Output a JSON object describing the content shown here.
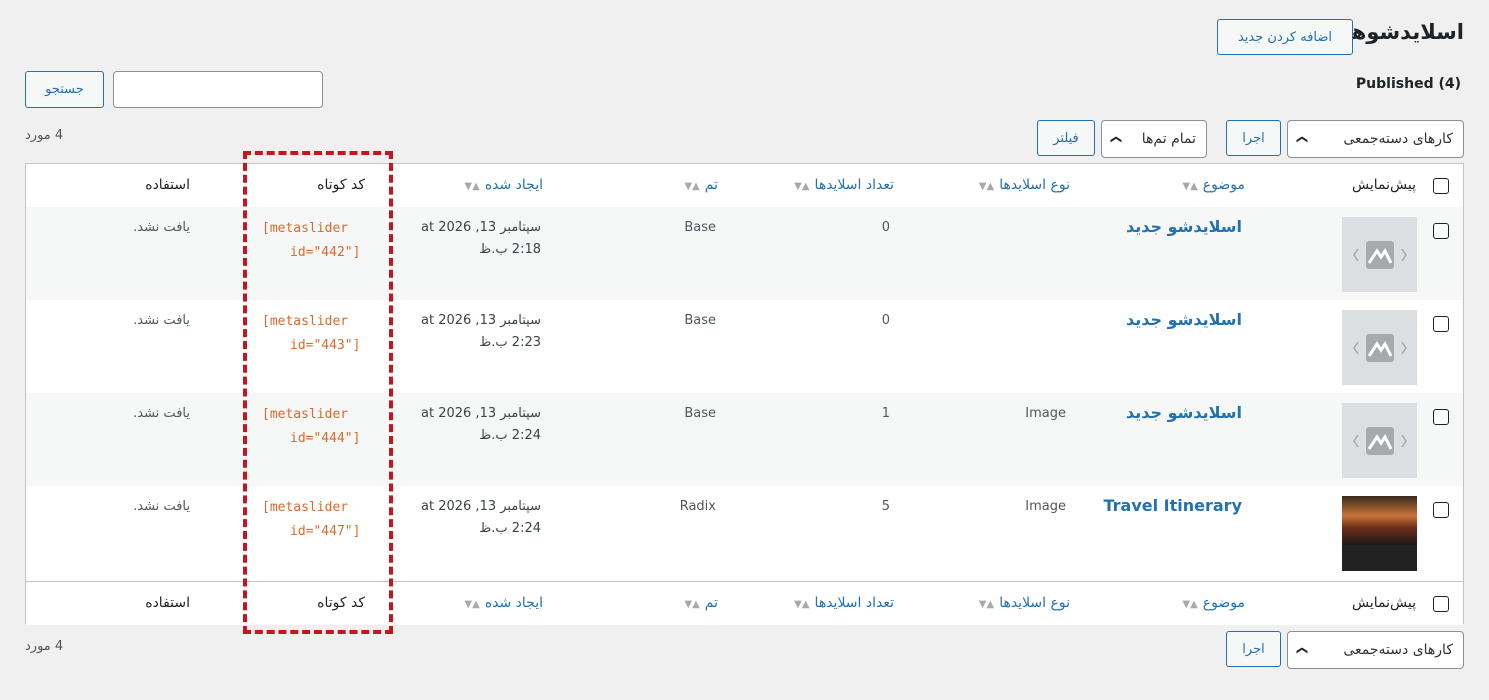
{
  "page": {
    "title": "اسلایدشوها",
    "add_new_label": "اضافه کردن جدید",
    "published_label": "Published (4)",
    "search_button": "جستجو",
    "search_value": "",
    "bulk_actions": "کارهای دسته‌جمعی",
    "apply_label": "اجرا",
    "theme_filter": "تمام تم‌ها",
    "filter_button": "فیلتر",
    "item_count": "4 مورد"
  },
  "table": {
    "columns": {
      "preview": "پیش‌نمایش",
      "title": "موضوع",
      "type": "نوع اسلایدها",
      "count": "تعداد اسلایدها",
      "theme": "تم",
      "created": "ایجاد شده",
      "shortcode": "کد کوتاه",
      "usage": "استفاده"
    },
    "rows": [
      {
        "title": "اسلایدشو جدید",
        "type": "",
        "count": "0",
        "theme": "Base",
        "date_line1": "سپتامبر 13, 2026 at",
        "date_line2": "2:18 ب.ظ",
        "code_line1": "[metaslider",
        "code_line2": "id=\"442\"]",
        "usage": "یافت نشد."
      },
      {
        "title": "اسلایدشو جدید",
        "type": "",
        "count": "0",
        "theme": "Base",
        "date_line1": "سپتامبر 13, 2026 at",
        "date_line2": "2:23 ب.ظ",
        "code_line1": "[metaslider",
        "code_line2": "id=\"443\"]",
        "usage": "یافت نشد."
      },
      {
        "title": "اسلایدشو جدید",
        "type": "Image",
        "count": "1",
        "theme": "Base",
        "date_line1": "سپتامبر 13, 2026 at",
        "date_line2": "2:24 ب.ظ",
        "code_line1": "[metaslider",
        "code_line2": "id=\"444\"]",
        "usage": "یافت نشد."
      },
      {
        "title": "Travel Itinerary",
        "type": "Image",
        "count": "5",
        "theme": "Radix",
        "date_line1": "سپتامبر 13, 2026 at",
        "date_line2": "2:24 ب.ظ",
        "code_line1": "[metaslider",
        "code_line2": "id=\"447\"]",
        "usage": "یافت نشد."
      }
    ]
  },
  "icons": {
    "placeholder": "slideshow-placeholder-icon",
    "sort": "sort-arrows-icon",
    "dropdown": "chevron-down-icon"
  },
  "colors": {
    "link": "#2271b1",
    "shortcode": "#d66b2e",
    "highlight": "#c4161c"
  }
}
